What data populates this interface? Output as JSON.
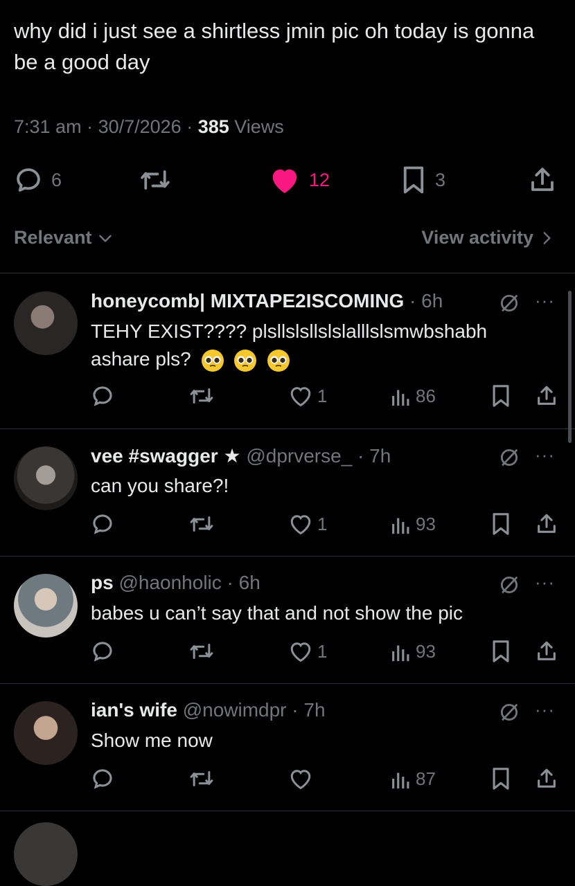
{
  "tweet": {
    "text": "why did i just see a shirtless jmin pic oh today is gonna be a good day",
    "time": "7:31 am",
    "date": "30/7/2026",
    "views_count": "385",
    "views_label": "Views",
    "replies": "6",
    "likes": "12",
    "bookmarks": "3",
    "liked_color": "#f91880"
  },
  "sort": {
    "label": "Relevant",
    "activity": "View activity"
  },
  "replies": [
    {
      "name": "honeycomb| MIXTAPE2ISCOMING",
      "handle": "",
      "time": "6h",
      "text": "TEHY EXIST???? plsllslsllslslalllslsmwbshabh ashare pls?",
      "emoji_count": 3,
      "likes": "1",
      "views": "86"
    },
    {
      "name": "vee #swagger ★",
      "handle": "@dprverse_",
      "time": "7h",
      "text": "can you share?!",
      "likes": "1",
      "views": "93"
    },
    {
      "name": "ps",
      "handle": "@haonholic",
      "time": "6h",
      "text": "babes u can’t say that and not show the pic",
      "likes": "1",
      "views": "93"
    },
    {
      "name": "ian's wife",
      "handle": "@nowimdpr",
      "time": "7h",
      "text": "Show me now",
      "likes": "",
      "views": "87"
    }
  ],
  "icons": [
    "reply-icon",
    "retweet-icon",
    "heart-icon",
    "bookmark-icon",
    "share-icon",
    "views-icon",
    "grok-icon",
    "more-icon",
    "chevron-down-icon",
    "chevron-right-icon"
  ]
}
